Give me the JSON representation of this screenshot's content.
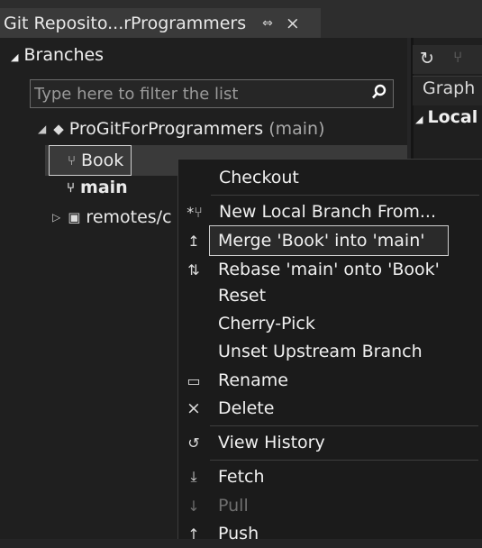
{
  "tab": {
    "title": "Git Reposito...rProgrammers",
    "pin": "⇔",
    "close": "×"
  },
  "branches": {
    "header": "Branches",
    "filter_placeholder": "Type here to filter the list",
    "repo_name": "ProGitForProgrammers",
    "repo_branch": "(main)",
    "items": [
      {
        "label": "Book"
      },
      {
        "label": "main"
      },
      {
        "label": "remotes/c"
      }
    ]
  },
  "graph": {
    "header": "Graph",
    "local": "Local"
  },
  "menu": {
    "items": [
      {
        "label": "Checkout",
        "icon": ""
      },
      {
        "label": "New Local Branch From...",
        "icon": "new-branch-icon"
      },
      {
        "label": "Merge 'Book' into 'main'",
        "icon": "merge-icon"
      },
      {
        "label": "Rebase 'main' onto 'Book'",
        "icon": "rebase-icon"
      },
      {
        "label": "Reset",
        "icon": ""
      },
      {
        "label": "Cherry-Pick",
        "icon": ""
      },
      {
        "label": "Unset Upstream Branch",
        "icon": ""
      },
      {
        "label": "Rename",
        "icon": "rename-icon"
      },
      {
        "label": "Delete",
        "icon": "delete-icon"
      },
      {
        "label": "View History",
        "icon": "history-icon"
      },
      {
        "label": "Fetch",
        "icon": "fetch-icon"
      },
      {
        "label": "Pull",
        "icon": "pull-icon"
      },
      {
        "label": "Push",
        "icon": "push-icon"
      }
    ]
  }
}
